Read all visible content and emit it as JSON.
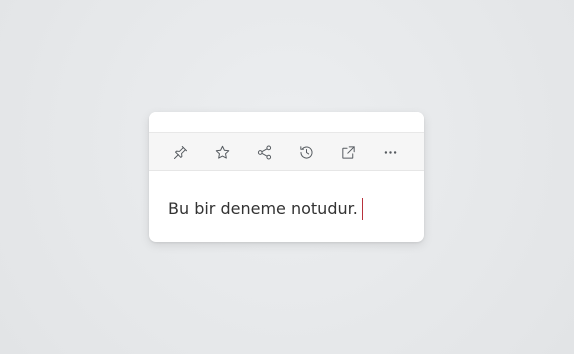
{
  "note": {
    "text": "Bu bir deneme notudur.",
    "caret_color": "#b8323c"
  },
  "toolbar": {
    "buttons": [
      {
        "name": "pin",
        "icon": "pin-icon"
      },
      {
        "name": "favorite",
        "icon": "star-icon"
      },
      {
        "name": "share",
        "icon": "share-icon"
      },
      {
        "name": "history",
        "icon": "history-icon"
      },
      {
        "name": "open-external",
        "icon": "external-link-icon"
      },
      {
        "name": "more",
        "icon": "more-horizontal-icon"
      }
    ]
  },
  "colors": {
    "background": "#e7e9eb",
    "card": "#ffffff",
    "toolbar": "#f6f6f6",
    "icon": "#555a5f"
  }
}
